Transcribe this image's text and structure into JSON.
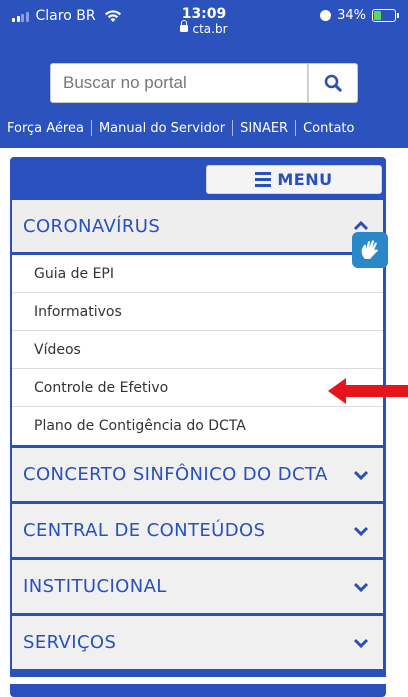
{
  "status_bar": {
    "carrier": "Claro BR",
    "time": "13:09",
    "url": "cta.br",
    "battery": "34%",
    "icons": [
      "signal-icon",
      "wifi-icon",
      "lock-icon",
      "alarm-icon",
      "battery-icon"
    ]
  },
  "search": {
    "placeholder": "Buscar no portal",
    "value": "",
    "icon": "search-icon"
  },
  "top_nav": {
    "links": [
      {
        "label": "Força Aérea"
      },
      {
        "label": "Manual do Servidor"
      },
      {
        "label": "SINAER"
      },
      {
        "label": "Contato"
      }
    ]
  },
  "menu": {
    "toggle_label": "MENU",
    "toggle_icon": "hamburger-icon",
    "sections": [
      {
        "label": "CORONAVÍRUS",
        "expanded": true,
        "items": [
          {
            "label": "Guia de EPI"
          },
          {
            "label": "Informativos"
          },
          {
            "label": "Vídeos"
          },
          {
            "label": "Controle de Efetivo"
          },
          {
            "label": "Plano de Contigência do DCTA"
          }
        ]
      },
      {
        "label": "CONCERTO SINFÔNICO DO DCTA",
        "expanded": false
      },
      {
        "label": "CENTRAL DE CONTEÚDOS",
        "expanded": false
      },
      {
        "label": "INSTITUCIONAL",
        "expanded": false
      },
      {
        "label": "SERVIÇOS",
        "expanded": false
      }
    ]
  },
  "accessibility_icon": "sign-language-hand-icon",
  "annotation_icon": "red-arrow-icon",
  "colors": {
    "brand_blue": "#2b52bd",
    "panel_bg": "#f0f0f0",
    "arrow_red": "#e8141b",
    "badge_blue": "#2a88c9"
  }
}
